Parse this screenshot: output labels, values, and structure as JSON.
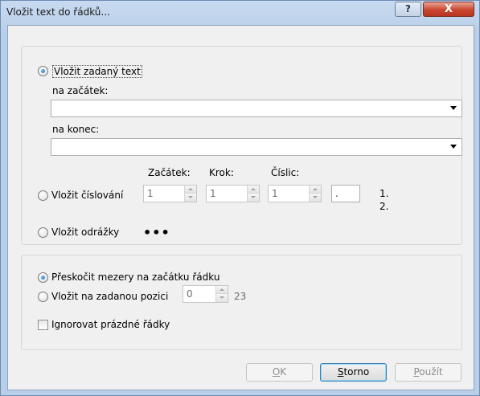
{
  "window": {
    "title": "Vložit text do řádků...",
    "help_label": "?",
    "close_label": "X"
  },
  "group1": {
    "insert_text_label": "Vložit zadaný text",
    "insert_text_selected": true,
    "start_label": "na začátek:",
    "start_value": "",
    "end_label": "na konec:",
    "end_value": "",
    "numbering_headers": {
      "start": "Začátek:",
      "step": "Krok:",
      "digits": "Číslic:"
    },
    "numbering_label": "Vložit číslování",
    "numbering_selected": false,
    "numbering_start": "1",
    "numbering_step": "1",
    "numbering_digits": "1",
    "numbering_suffix": ".",
    "sample_line1": "1.",
    "sample_line2": "2.",
    "bullets_label": "Vložit odrážky",
    "bullets_selected": false,
    "bullets_sample": "•••"
  },
  "group2": {
    "skip_spaces_label": "Přeskočit mezery na začátku řádku",
    "skip_spaces_selected": true,
    "insert_position_label": "Vložit na zadanou pozici",
    "insert_position_selected": false,
    "position_value": "0",
    "position_max": "23",
    "ignore_empty_label": "Ignorovat prázdné řádky",
    "ignore_empty_checked": false
  },
  "buttons": {
    "ok_first": "O",
    "ok_rest": "K",
    "cancel_first": "S",
    "cancel_rest": "torno",
    "apply_first": "P",
    "apply_rest": "oužít"
  }
}
